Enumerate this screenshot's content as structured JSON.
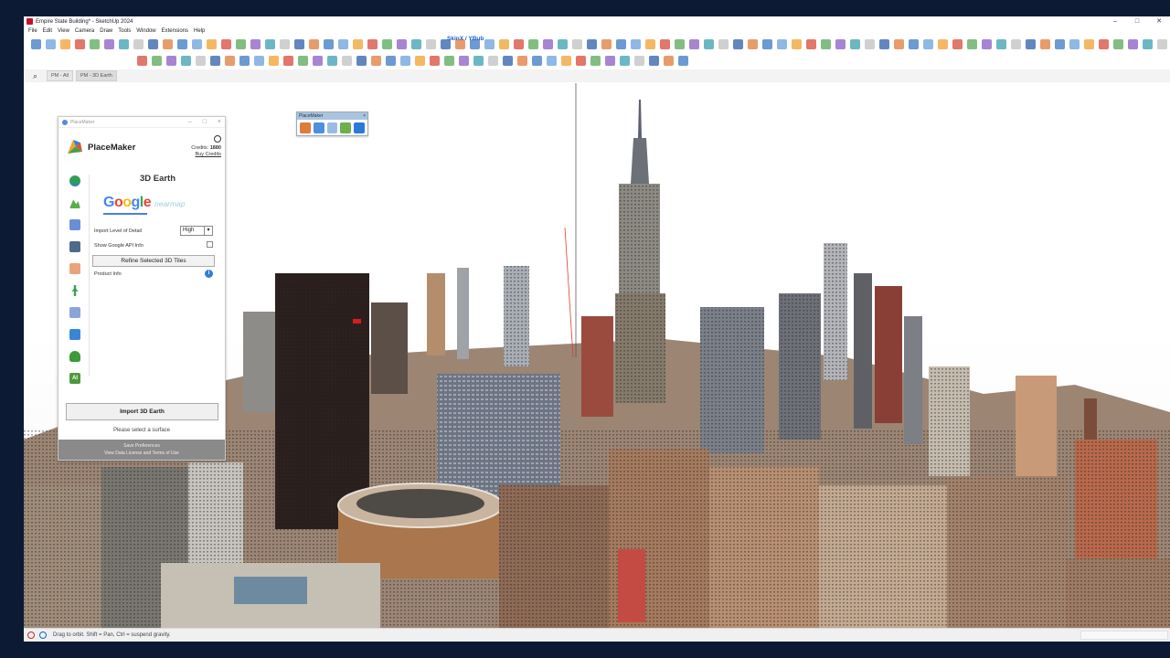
{
  "window": {
    "title": "Empire State Building* - SketchUp 2024",
    "controls": [
      "–",
      "□",
      "✕"
    ]
  },
  "menu": [
    "File",
    "Edit",
    "View",
    "Camera",
    "Draw",
    "Tools",
    "Window",
    "Extensions",
    "Help"
  ],
  "toolbar": {
    "skinx_label": "SkinX / YBub"
  },
  "tabs": [
    {
      "label": "PM - All",
      "active": false
    },
    {
      "label": "PM - 3D Earth",
      "active": true
    }
  ],
  "placemaker": {
    "window_title": "PlaceMaker",
    "brand": "PlaceMaker",
    "credits_label": "Credits:",
    "credits_value": "1880",
    "buy_credits": "Buy Credits",
    "heading": "3D Earth",
    "provider_google": [
      "G",
      "o",
      "o",
      "g",
      "l",
      "e"
    ],
    "provider_nearmap": "nearmap",
    "lod_label": "Import Level of Detail",
    "lod_value": "High",
    "show_api_label": "Show Google API Info",
    "show_api_checked": false,
    "refine_button": "Refine Selected 3D Tiles",
    "product_info": "Product Info",
    "import_button": "Import 3D Earth",
    "status": "Please select a surface",
    "save_prefs": "Save Preferences",
    "license": "View Data License and Terms of Use"
  },
  "mini_toolbar": {
    "title": "PlaceMaker",
    "close": "×"
  },
  "statusbar": {
    "hint": "Drag to orbit. Shift = Pan, Ctrl = suspend gravity."
  },
  "icons": {
    "sidebar": [
      "globe-icon",
      "terrain-icon",
      "satellite-icon",
      "road-icon",
      "map-layer-icon",
      "person-icon",
      "building-icon",
      "river-icon",
      "tree-icon",
      "ai-icon"
    ],
    "colors": {
      "accent_blue": "#2f7de1",
      "title_red": "#c8102e"
    }
  }
}
